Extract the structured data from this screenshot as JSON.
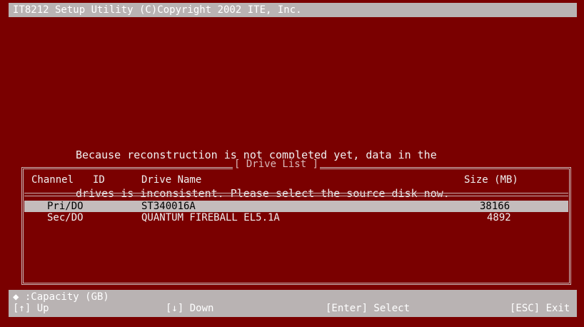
{
  "title": "IT8212 Setup Utility (C)Copyright 2002 ITE, Inc.",
  "message": {
    "line1": "Because reconstruction is not completed yet, data in the",
    "line2": "drives is inconsistent. Please select the source disk now."
  },
  "drive_list": {
    "title": "[ Drive List ]",
    "columns": {
      "channel": "Channel",
      "id": "ID",
      "drive_name": "Drive Name",
      "size": "Size (MB)"
    },
    "rows": [
      {
        "channel": "Pri/DO",
        "name": "ST340016A",
        "size": "38166",
        "selected": true
      },
      {
        "channel": "Sec/DO",
        "name": "QUANTUM FIREBALL EL5.1A",
        "size": "4892",
        "selected": false
      }
    ]
  },
  "footer": {
    "capacity": "◆ :Capacity (GB)",
    "up": "[↑] Up",
    "down": "[↓] Down",
    "select": "[Enter] Select",
    "exit": "[ESC] Exit"
  },
  "colors": {
    "background": "#7a0000",
    "bar": "#b9b3b3",
    "text": "#f0f0f0"
  }
}
